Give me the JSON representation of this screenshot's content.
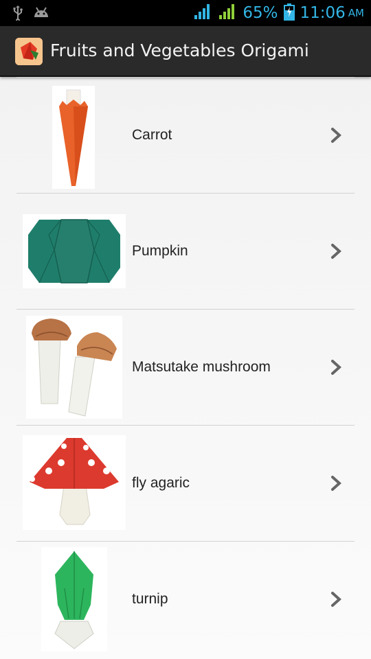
{
  "status_bar": {
    "battery": "65%",
    "time": "11:06",
    "ampm": "AM",
    "icons": [
      "usb-icon",
      "android-icon",
      "wifi-signal-icon",
      "cell-signal-icon",
      "battery-icon"
    ]
  },
  "app": {
    "title": "Fruits and Vegetables Origami",
    "icon": "origami-fruit-app-icon"
  },
  "list": {
    "items": [
      {
        "label": "Carrot",
        "thumbnail": "carrot-origami-image"
      },
      {
        "label": "Pumpkin",
        "thumbnail": "pumpkin-origami-image"
      },
      {
        "label": "Matsutake mushroom",
        "thumbnail": "matsutake-mushroom-origami-image"
      },
      {
        "label": "fly agaric",
        "thumbnail": "fly-agaric-origami-image"
      },
      {
        "label": "turnip",
        "thumbnail": "turnip-origami-image"
      }
    ],
    "chevron_icon": "chevron-right-icon"
  },
  "colors": {
    "status_bar_bg": "#000000",
    "status_accent": "#33b5e5",
    "signal_green": "#8fcf3a",
    "action_bar_bg": "#2a2a2a",
    "list_bg": "#f3f3f3",
    "chevron": "#666666"
  }
}
